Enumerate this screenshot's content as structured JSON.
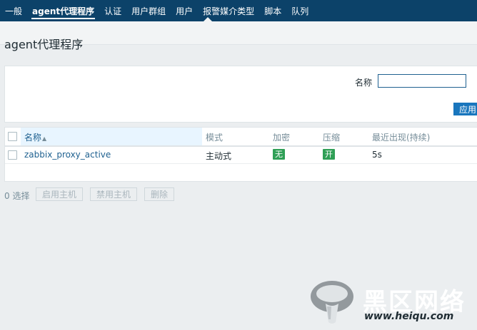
{
  "nav": {
    "tabs": [
      "一般",
      "agent代理程序",
      "认证",
      "用户群组",
      "用户",
      "报警媒介类型",
      "脚本",
      "队列"
    ],
    "active_tab": "agent代理程序"
  },
  "page": {
    "title": "agent代理程序"
  },
  "filter": {
    "name_label": "名称",
    "name_value": "",
    "apply_label": "应用"
  },
  "table": {
    "columns": {
      "name": "名称",
      "name_sort_indicator": "▲",
      "mode": "模式",
      "encryption": "加密",
      "compression": "压缩",
      "last_seen": "最近出现(持续)"
    },
    "rows": [
      {
        "name": "zabbix_proxy_active",
        "mode": "主动式",
        "encryption": "无",
        "compression": "开",
        "last_seen": "5s"
      }
    ]
  },
  "actions": {
    "selected_count": "0 选择",
    "enable_label": "启用主机",
    "disable_label": "禁用主机",
    "delete_label": "删除"
  },
  "watermark": {
    "text": "黑区网络",
    "url": "www.heiqu.com"
  },
  "colors": {
    "nav_bg": "#0c4269",
    "link": "#1f6190",
    "badge_green": "#2f9f56",
    "apply_btn": "#1976bd"
  }
}
